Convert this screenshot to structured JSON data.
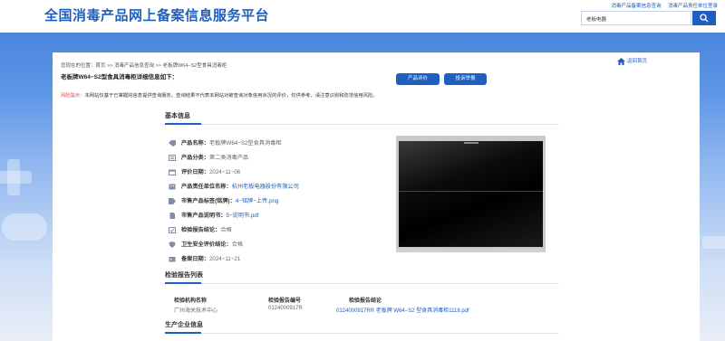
{
  "header": {
    "site_title": "全国消毒产品网上备案信息服务平台",
    "links": [
      "消毒产品备案信息查询",
      "消毒产品责任单位登录"
    ],
    "search_value": "老板电器"
  },
  "breadcrumb": "您现在的位置：首页 >> 消毒产品信息查询 >> 老板牌W64−S2型食具消毒柜",
  "home_link": "返回首页",
  "page_heading": "老板牌W64−S2型食具消毒柜详细信息如下：",
  "buttons": {
    "evaluate": "产品评价",
    "complaint": "投诉举报"
  },
  "notice": {
    "label": "风险提示：",
    "text": "本网站仅基于已掌握的信息提供查询服务。查询结果不代表本网站对被查询对象信用状况的评价，仅供参考，请注意识别和防范信用风险。"
  },
  "basic_info": {
    "title": "基本信息",
    "fields": [
      {
        "label": "产品名称：",
        "value": "老板牌W64−S2型食具消毒柜"
      },
      {
        "label": "产品分类：",
        "value": "第二类消毒产品"
      },
      {
        "label": "评价日期：",
        "value": "2024−11−06"
      },
      {
        "label": "产品责任单位名称：",
        "value": "杭州老板电器股份有限公司"
      },
      {
        "label": "市售产品标签(铭牌)：",
        "value": "4−铭牌−上传.png"
      },
      {
        "label": "市售产品说明书：",
        "value": "5−说明书.pdf"
      },
      {
        "label": "检验报告结论：",
        "value": "合格"
      },
      {
        "label": "卫生安全评价结论：",
        "value": "合格"
      },
      {
        "label": "备案日期：",
        "value": "2024−11−21"
      }
    ]
  },
  "report_list": {
    "title": "检验报告列表",
    "headers": [
      "检验机构名称",
      "检验报告编号",
      "检验报告结论"
    ],
    "rows": [
      [
        "广州海关技术中心",
        "0124000917R",
        "0124000917RR 老板牌 W64−S2 型食具消毒柜1118.pdf"
      ]
    ]
  },
  "producer": {
    "title": "生产企业信息"
  },
  "colors": {
    "primary": "#1e5fbf",
    "warning": "#e03a3a"
  }
}
